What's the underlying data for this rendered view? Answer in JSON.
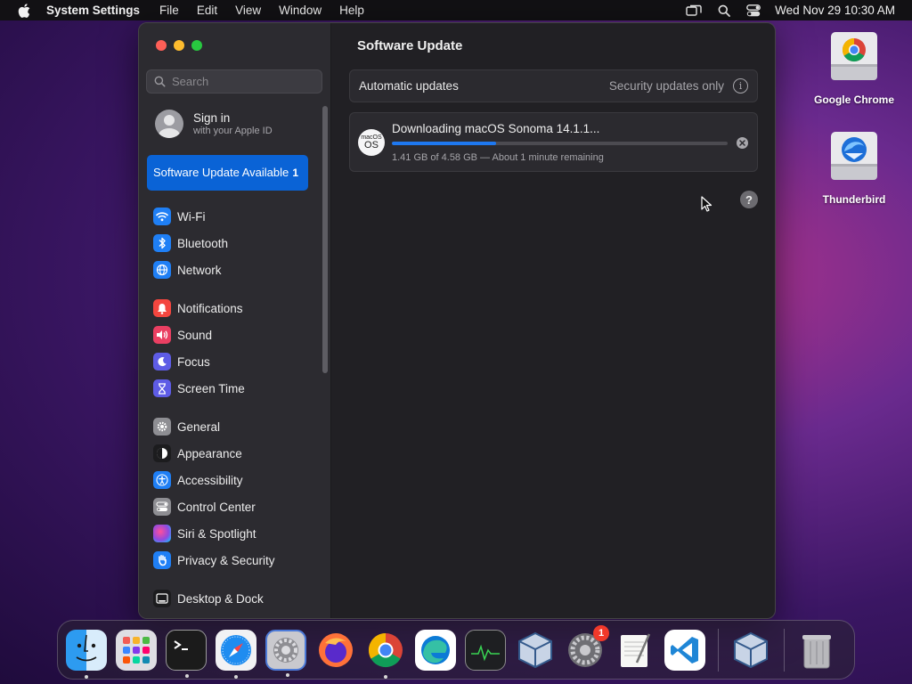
{
  "menubar": {
    "app_name": "System Settings",
    "menus": [
      "File",
      "Edit",
      "View",
      "Window",
      "Help"
    ],
    "clock": "Wed Nov 29  10:30 AM"
  },
  "sidebar": {
    "search_placeholder": "Search",
    "account": {
      "title": "Sign in",
      "subtitle": "with your Apple ID"
    },
    "update_item": {
      "label": "Software Update Available",
      "count": "1"
    },
    "groups": [
      [
        {
          "label": "Wi-Fi",
          "icon": "wifi-icon",
          "color": "#1f7ff5"
        },
        {
          "label": "Bluetooth",
          "icon": "bluetooth-icon",
          "color": "#1f7ff5"
        },
        {
          "label": "Network",
          "icon": "network-globe-icon",
          "color": "#1f7ff5"
        }
      ],
      [
        {
          "label": "Notifications",
          "icon": "bell-icon",
          "color": "#f4463f"
        },
        {
          "label": "Sound",
          "icon": "speaker-icon",
          "color": "#ea3f62"
        },
        {
          "label": "Focus",
          "icon": "moon-icon",
          "color": "#5e5ce6"
        },
        {
          "label": "Screen Time",
          "icon": "hourglass-icon",
          "color": "#5e5ce6"
        }
      ],
      [
        {
          "label": "General",
          "icon": "gear-icon",
          "color": "#8e8e93"
        },
        {
          "label": "Appearance",
          "icon": "appearance-icon",
          "color": "#1c1c1e"
        },
        {
          "label": "Accessibility",
          "icon": "accessibility-icon",
          "color": "#1f7ff5"
        },
        {
          "label": "Control Center",
          "icon": "control-center-icon",
          "color": "#8e8e93"
        },
        {
          "label": "Siri & Spotlight",
          "icon": "siri-icon",
          "color": "#8f4ae0"
        },
        {
          "label": "Privacy & Security",
          "icon": "hand-icon",
          "color": "#1f7ff5"
        }
      ],
      [
        {
          "label": "Desktop & Dock",
          "icon": "desktop-dock-icon",
          "color": "#1c1c1e"
        }
      ]
    ]
  },
  "content": {
    "title": "Software Update",
    "automatic": {
      "label": "Automatic updates",
      "value": "Security updates only"
    },
    "download": {
      "icon_small": "macOS",
      "icon_big": "OS",
      "title": "Downloading macOS Sonoma 14.1.1...",
      "progress": 0.31,
      "status": "1.41 GB of 4.58 GB — About 1 minute remaining"
    },
    "help_label": "?"
  },
  "desktop_icons": [
    {
      "label": "Google Chrome",
      "icon": "chrome-drive-icon"
    },
    {
      "label": "Thunderbird",
      "icon": "thunderbird-drive-icon"
    }
  ],
  "dock": {
    "apps": [
      {
        "name": "finder",
        "icon": "finder-icon",
        "running": true
      },
      {
        "name": "launchpad",
        "icon": "launchpad-icon",
        "running": false
      },
      {
        "name": "terminal",
        "icon": "terminal-icon",
        "running": true
      },
      {
        "name": "safari",
        "icon": "safari-icon",
        "running": true
      },
      {
        "name": "system-settings",
        "icon": "system-settings-icon",
        "running": true
      },
      {
        "name": "firefox",
        "icon": "firefox-icon",
        "running": false
      },
      {
        "name": "chrome",
        "icon": "chrome-icon",
        "running": true
      },
      {
        "name": "edge",
        "icon": "edge-icon",
        "running": false
      },
      {
        "name": "activity-monitor",
        "icon": "activity-monitor-icon",
        "running": false
      },
      {
        "name": "virtualbox",
        "icon": "virtualbox-icon",
        "running": false
      },
      {
        "name": "system-preferences",
        "icon": "system-preferences-icon",
        "running": false,
        "badge": "1"
      },
      {
        "name": "textedit",
        "icon": "textedit-icon",
        "running": false
      },
      {
        "name": "vscode",
        "icon": "vscode-icon",
        "running": false
      }
    ],
    "recent": {
      "name": "virtualbox",
      "icon": "virtualbox-icon"
    },
    "trash": {
      "name": "trash",
      "icon": "trash-icon"
    }
  }
}
